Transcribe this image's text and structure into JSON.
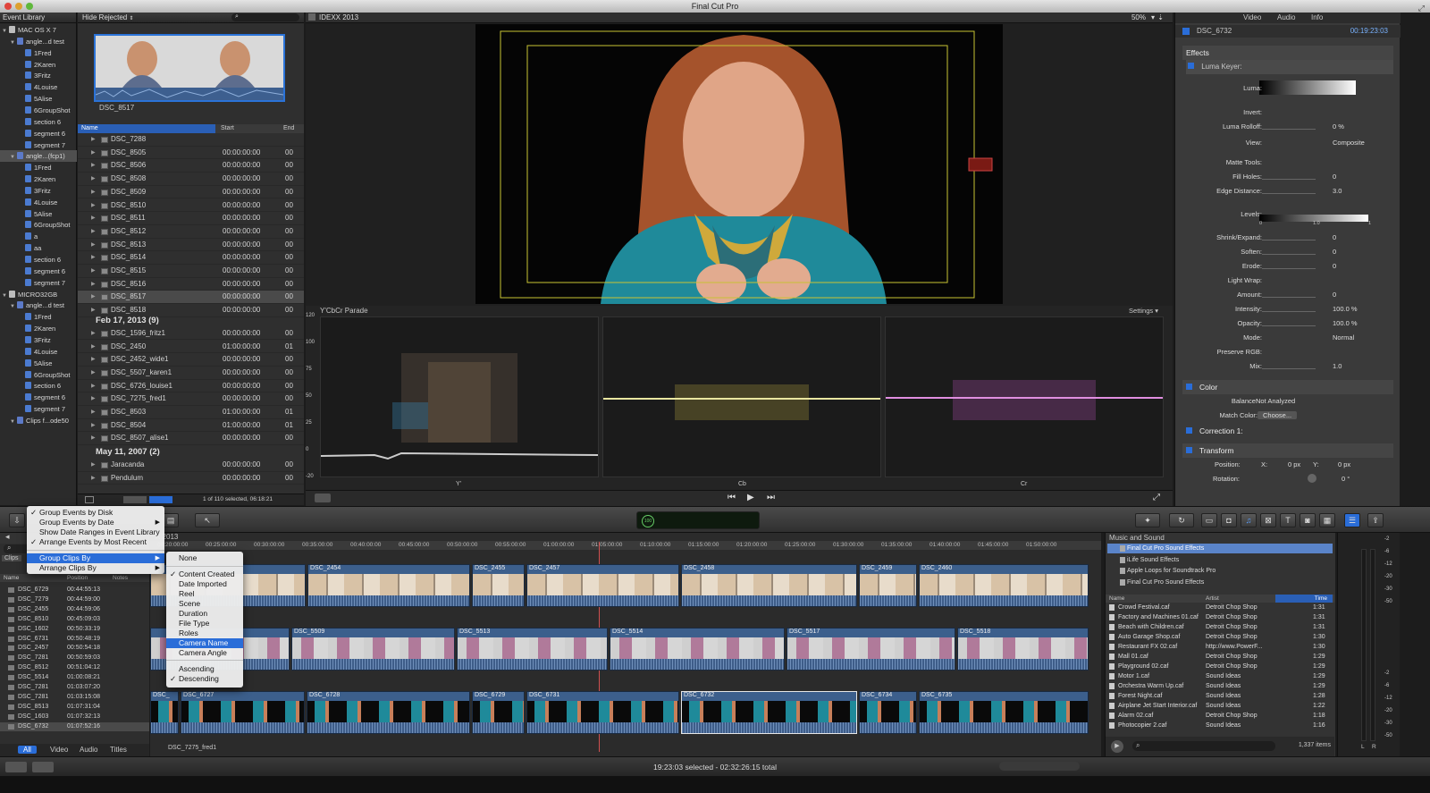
{
  "window": {
    "title": "Final Cut Pro"
  },
  "event_library": {
    "header": "Event Library",
    "items": [
      {
        "label": "MAC OS X 7",
        "icon": "disk-icon",
        "level": 0
      },
      {
        "label": "angle...d test",
        "icon": "event-icon",
        "level": 1
      },
      {
        "label": "1Fred",
        "icon": "folder-icon",
        "level": 2
      },
      {
        "label": "2Karen",
        "icon": "folder-icon",
        "level": 2
      },
      {
        "label": "3Fritz",
        "icon": "folder-icon",
        "level": 2
      },
      {
        "label": "4Louise",
        "icon": "folder-icon",
        "level": 2
      },
      {
        "label": "5Alise",
        "icon": "folder-icon",
        "level": 2
      },
      {
        "label": "6GroupShot",
        "icon": "folder-icon",
        "level": 2
      },
      {
        "label": "section 6",
        "icon": "folder-icon",
        "level": 2
      },
      {
        "label": "segment 6",
        "icon": "folder-icon",
        "level": 2
      },
      {
        "label": "segment 7",
        "icon": "folder-icon",
        "level": 2
      },
      {
        "label": "angle...(fcp1)",
        "icon": "event-icon",
        "level": 1
      },
      {
        "label": "1Fred",
        "icon": "folder-icon",
        "level": 2
      },
      {
        "label": "2Karen",
        "icon": "folder-icon",
        "level": 2
      },
      {
        "label": "3Fritz",
        "icon": "folder-icon",
        "level": 2
      },
      {
        "label": "4Louise",
        "icon": "folder-icon",
        "level": 2
      },
      {
        "label": "5Alise",
        "icon": "folder-icon",
        "level": 2
      },
      {
        "label": "6GroupShot",
        "icon": "folder-icon",
        "level": 2
      },
      {
        "label": "a",
        "icon": "folder-icon",
        "level": 2
      },
      {
        "label": "aa",
        "icon": "folder-icon",
        "level": 2
      },
      {
        "label": "section 6",
        "icon": "folder-icon",
        "level": 2
      },
      {
        "label": "segment 6",
        "icon": "folder-icon",
        "level": 2
      },
      {
        "label": "segment 7",
        "icon": "folder-icon",
        "level": 2
      },
      {
        "label": "MICRO32GB",
        "icon": "disk-icon",
        "level": 0
      },
      {
        "label": "angle...d test",
        "icon": "event-icon",
        "level": 1
      },
      {
        "label": "1Fred",
        "icon": "folder-icon",
        "level": 2
      },
      {
        "label": "2Karen",
        "icon": "folder-icon",
        "level": 2
      },
      {
        "label": "3Fritz",
        "icon": "folder-icon",
        "level": 2
      },
      {
        "label": "4Louise",
        "icon": "folder-icon",
        "level": 2
      },
      {
        "label": "5Alise",
        "icon": "folder-icon",
        "level": 2
      },
      {
        "label": "6GroupShot",
        "icon": "folder-icon",
        "level": 2
      },
      {
        "label": "section 6",
        "icon": "folder-icon",
        "level": 2
      },
      {
        "label": "segment 6",
        "icon": "folder-icon",
        "level": 2
      },
      {
        "label": "segment 7",
        "icon": "folder-icon",
        "level": 2
      },
      {
        "label": "Clips f...ode50",
        "icon": "event-icon",
        "level": 1
      }
    ]
  },
  "browser": {
    "filter": "Hide Rejected",
    "filmstrip_label": "DSC_8517",
    "columns": {
      "name": "Name",
      "start": "Start",
      "end": "End"
    },
    "rows_a": [
      {
        "name": "DSC_7288",
        "start": "",
        "end": ""
      },
      {
        "name": "DSC_8505",
        "start": "00:00:00:00",
        "end": "00"
      },
      {
        "name": "DSC_8506",
        "start": "00:00:00:00",
        "end": "00"
      },
      {
        "name": "DSC_8508",
        "start": "00:00:00:00",
        "end": "00"
      },
      {
        "name": "DSC_8509",
        "start": "00:00:00:00",
        "end": "00"
      },
      {
        "name": "DSC_8510",
        "start": "00:00:00:00",
        "end": "00"
      },
      {
        "name": "DSC_8511",
        "start": "00:00:00:00",
        "end": "00"
      },
      {
        "name": "DSC_8512",
        "start": "00:00:00:00",
        "end": "00"
      },
      {
        "name": "DSC_8513",
        "start": "00:00:00:00",
        "end": "00"
      },
      {
        "name": "DSC_8514",
        "start": "00:00:00:00",
        "end": "00"
      },
      {
        "name": "DSC_8515",
        "start": "00:00:00:00",
        "end": "00"
      },
      {
        "name": "DSC_8516",
        "start": "00:00:00:00",
        "end": "00"
      },
      {
        "name": "DSC_8517",
        "start": "00:00:00:00",
        "end": "00"
      },
      {
        "name": "DSC_8518",
        "start": "00:00:00:00",
        "end": "00"
      }
    ],
    "group_b": "Feb 17, 2013  (9)",
    "rows_b": [
      {
        "name": "DSC_1596_fritz1",
        "start": "00:00:00:00",
        "end": "00"
      },
      {
        "name": "DSC_2450",
        "start": "01:00:00:00",
        "end": "01"
      },
      {
        "name": "DSC_2452_wide1",
        "start": "00:00:00:00",
        "end": "00"
      },
      {
        "name": "DSC_5507_karen1",
        "start": "00:00:00:00",
        "end": "00"
      },
      {
        "name": "DSC_6726_louise1",
        "start": "00:00:00:00",
        "end": "00"
      },
      {
        "name": "DSC_7275_fred1",
        "start": "00:00:00:00",
        "end": "00"
      },
      {
        "name": "DSC_8503",
        "start": "01:00:00:00",
        "end": "01"
      },
      {
        "name": "DSC_8504",
        "start": "01:00:00:00",
        "end": "01"
      },
      {
        "name": "DSC_8507_alise1",
        "start": "00:00:00:00",
        "end": "00"
      }
    ],
    "group_c": "May 11, 2007  (2)",
    "rows_c": [
      {
        "name": "Jaracanda",
        "start": "00:00:00:00",
        "end": "00"
      },
      {
        "name": "Pendulum",
        "start": "00:00:00:00",
        "end": "00"
      }
    ],
    "footer": "1 of 110 selected, 06:18:21"
  },
  "viewer": {
    "title": "IDEXX 2013",
    "zoom": "50%"
  },
  "scopes": {
    "title": "Y'CbCr Parade",
    "settings": "Settings",
    "ticks": [
      "120",
      "100",
      "75",
      "50",
      "25",
      "0",
      "-20"
    ],
    "labels": [
      "Y'",
      "Cb",
      "Cr"
    ]
  },
  "inspector": {
    "tabs": [
      "Video",
      "Audio",
      "Info"
    ],
    "clip_name": "DSC_6732",
    "clip_time": "00:19:23:03",
    "effects_label": "Effects",
    "luma_keyer": "Luma Keyer:",
    "rows": [
      {
        "label": "Luma:",
        "value": ""
      },
      {
        "label": "Invert:",
        "value": ""
      },
      {
        "label": "Luma Rolloff:",
        "value": "0  %"
      },
      {
        "label": "View:",
        "value": "Composite"
      },
      {
        "label": "Matte Tools:",
        "value": ""
      },
      {
        "label": "Fill Holes:",
        "value": "0"
      },
      {
        "label": "Edge Distance:",
        "value": "3.0"
      },
      {
        "label": "Levels:",
        "value": ""
      },
      {
        "label": "Shrink/Expand:",
        "value": "0"
      },
      {
        "label": "Soften:",
        "value": "0"
      },
      {
        "label": "Erode:",
        "value": "0"
      },
      {
        "label": "Light Wrap:",
        "value": ""
      },
      {
        "label": "Amount:",
        "value": "0"
      },
      {
        "label": "Intensity:",
        "value": "100.0  %"
      },
      {
        "label": "Opacity:",
        "value": "100.0  %"
      },
      {
        "label": "Mode:",
        "value": "Normal"
      },
      {
        "label": "Preserve RGB:",
        "value": ""
      },
      {
        "label": "Mix:",
        "value": "1.0"
      }
    ],
    "levels_ticks": [
      "0",
      "1.0",
      "1"
    ],
    "color": {
      "title": "Color",
      "balance_label": "Balance:",
      "balance_value": "Not Analyzed",
      "match_label": "Match Color:",
      "match_button": "Choose..."
    },
    "correction": "Correction 1:",
    "transform": {
      "title": "Transform",
      "position_label": "Position:",
      "x_label": "X:",
      "x_value": "0  px",
      "y_label": "Y:",
      "y_value": "0  px",
      "rotation_label": "Rotation:",
      "rotation_value": "0 °"
    }
  },
  "toolbar": {
    "timecode": "100"
  },
  "timeline": {
    "project_name": "X 2013",
    "ruler": [
      "00:20:00:00",
      "00:25:00:00",
      "00:30:00:00",
      "00:35:00:00",
      "00:40:00:00",
      "00:45:00:00",
      "00:50:00:00",
      "00:55:00:00",
      "01:00:00:00",
      "01:05:00:00",
      "01:10:00:00",
      "01:15:00:00",
      "01:20:00:00",
      "01:25:00:00",
      "01:30:00:00",
      "01:35:00:00",
      "01:40:00:00",
      "01:45:00:00",
      "01:50:00:00"
    ],
    "track1": [
      "",
      "DSC_2454",
      "DSC_2455",
      "DSC_2457",
      "DSC_2458",
      "DSC_2459",
      "DSC_2460"
    ],
    "track2": [
      "",
      "DSC_5509",
      "DSC_5513",
      "DSC_5514",
      "DSC_5517",
      "DSC_5518"
    ],
    "track3": [
      "DSC_",
      "DSC_6727",
      "DSC_6728",
      "DSC_6729",
      "DSC_6731",
      "DSC_6732",
      "DSC_6734",
      "DSC_6735"
    ],
    "bottom_clip": "DSC_7275_fred1"
  },
  "clips_list": {
    "search_label": "Clips",
    "columns": {
      "name": "Name",
      "position": "Position",
      "notes": "Notes"
    },
    "rows": [
      {
        "name": "DSC_6729",
        "position": "00:44:55:13"
      },
      {
        "name": "DSC_7279",
        "position": "00:44:59:00"
      },
      {
        "name": "DSC_2455",
        "position": "00:44:59:06"
      },
      {
        "name": "DSC_8510",
        "position": "00:45:09:03"
      },
      {
        "name": "DSC_1602",
        "position": "00:50:33:19"
      },
      {
        "name": "DSC_6731",
        "position": "00:50:48:19"
      },
      {
        "name": "DSC_2457",
        "position": "00:50:54:18"
      },
      {
        "name": "DSC_7281",
        "position": "00:50:59:03"
      },
      {
        "name": "DSC_8512",
        "position": "00:51:04:12"
      },
      {
        "name": "DSC_5514",
        "position": "01:00:08:21"
      },
      {
        "name": "DSC_7281",
        "position": "01:03:07:20"
      },
      {
        "name": "DSC_7281",
        "position": "01:03:15:08"
      },
      {
        "name": "DSC_8513",
        "position": "01:07:31:04"
      },
      {
        "name": "DSC_1603",
        "position": "01:07:32:13"
      },
      {
        "name": "DSC_6732",
        "position": "01:07:52:16"
      }
    ],
    "tabs": [
      "All",
      "Video",
      "Audio",
      "Titles"
    ]
  },
  "sound": {
    "title": "Music and Sound",
    "sources": [
      "Final Cut Pro Sound Effects",
      "iLife Sound Effects",
      "Apple Loops for Soundtrack Pro",
      "Final Cut Pro Sound Effects"
    ],
    "columns": {
      "name": "Name",
      "artist": "Artist",
      "time": "Time"
    },
    "rows": [
      {
        "name": "Crowd Festival.caf",
        "artist": "Detroit Chop Shop",
        "time": "1:31"
      },
      {
        "name": "Factory and Machines 01.caf",
        "artist": "Detroit Chop Shop",
        "time": "1:31"
      },
      {
        "name": "Beach with Children.caf",
        "artist": "Detroit Chop Shop",
        "time": "1:31"
      },
      {
        "name": "Auto Garage Shop.caf",
        "artist": "Detroit Chop Shop",
        "time": "1:30"
      },
      {
        "name": "Restaurant FX 02.caf",
        "artist": "http://www.PowerF...",
        "time": "1:30"
      },
      {
        "name": "Mall 01.caf",
        "artist": "Detroit Chop Shop",
        "time": "1:29"
      },
      {
        "name": "Playground 02.caf",
        "artist": "Detroit Chop Shop",
        "time": "1:29"
      },
      {
        "name": "Motor 1.caf",
        "artist": "Sound Ideas",
        "time": "1:29"
      },
      {
        "name": "Orchestra Warm Up.caf",
        "artist": "Sound Ideas",
        "time": "1:29"
      },
      {
        "name": "Forest Night.caf",
        "artist": "Sound Ideas",
        "time": "1:28"
      },
      {
        "name": "Airplane Jet Start Interior.caf",
        "artist": "Sound Ideas",
        "time": "1:22"
      },
      {
        "name": "Alarm 02.caf",
        "artist": "Detroit Chop Shop",
        "time": "1:18"
      },
      {
        "name": "Photocopier 2.caf",
        "artist": "Sound Ideas",
        "time": "1:16"
      }
    ],
    "count": "1,337 items"
  },
  "meters": {
    "ticks": [
      "-2",
      "-6",
      "-12",
      "-20",
      "-30",
      "-50"
    ],
    "low_ticks": [
      "-2",
      "-6",
      "-12",
      "-20",
      "-30",
      "-50"
    ],
    "channels": [
      "L",
      "R"
    ]
  },
  "menu_main": {
    "items": [
      {
        "label": "Group Events by Disk",
        "checked": true,
        "submenu": false
      },
      {
        "label": "Group Events by Date",
        "checked": false,
        "submenu": true
      },
      {
        "label": "Show Date Ranges in Event Library",
        "checked": false,
        "submenu": false
      },
      {
        "label": "Arrange Events by Most Recent",
        "checked": true,
        "submenu": false
      },
      {
        "label": "Group Clips By",
        "checked": false,
        "submenu": true
      },
      {
        "label": "Arrange Clips By",
        "checked": false,
        "submenu": true
      }
    ]
  },
  "menu_sub": {
    "items": [
      {
        "label": "None",
        "checked": false
      },
      {
        "label": "Content Created",
        "checked": true
      },
      {
        "label": "Date Imported",
        "checked": false
      },
      {
        "label": "Reel",
        "checked": false
      },
      {
        "label": "Scene",
        "checked": false
      },
      {
        "label": "Duration",
        "checked": false
      },
      {
        "label": "File Type",
        "checked": false
      },
      {
        "label": "Roles",
        "checked": false
      },
      {
        "label": "Camera Name",
        "checked": false
      },
      {
        "label": "Camera Angle",
        "checked": false
      },
      {
        "label": "Ascending",
        "checked": false
      },
      {
        "label": "Descending",
        "checked": true
      }
    ]
  },
  "status": {
    "text": "19:23:03 selected - 02:32:26:15 total"
  },
  "colors": {
    "accent": "#2a6dd8",
    "clip_blue": "#3c5f8c"
  }
}
